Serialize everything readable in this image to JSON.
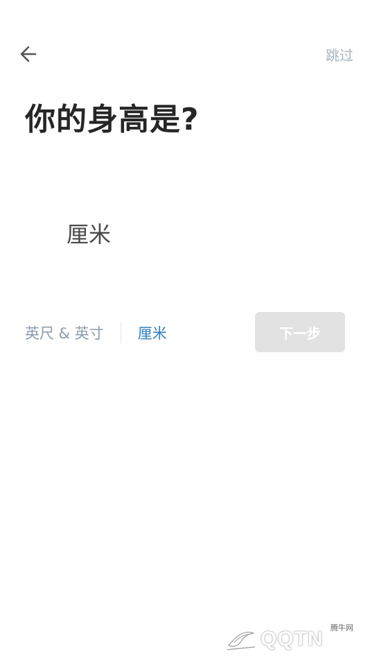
{
  "header": {
    "back_icon": "arrow-left-icon",
    "skip_label": "跳过"
  },
  "title": "你的身高是?",
  "height_input": {
    "value": "",
    "unit": "厘米"
  },
  "unit_toggle": {
    "options": [
      {
        "label": "英尺 & 英寸",
        "active": false
      },
      {
        "label": "厘米",
        "active": true
      }
    ]
  },
  "next_button": {
    "label": "下一步",
    "enabled": false
  },
  "watermark": {
    "text": "QQTN",
    "small_text": "腾牛网"
  },
  "colors": {
    "accent": "#2f80c4",
    "muted": "#8a9aaa",
    "skip": "#a7b4c0",
    "disabled_button": "#e2e2e2"
  }
}
